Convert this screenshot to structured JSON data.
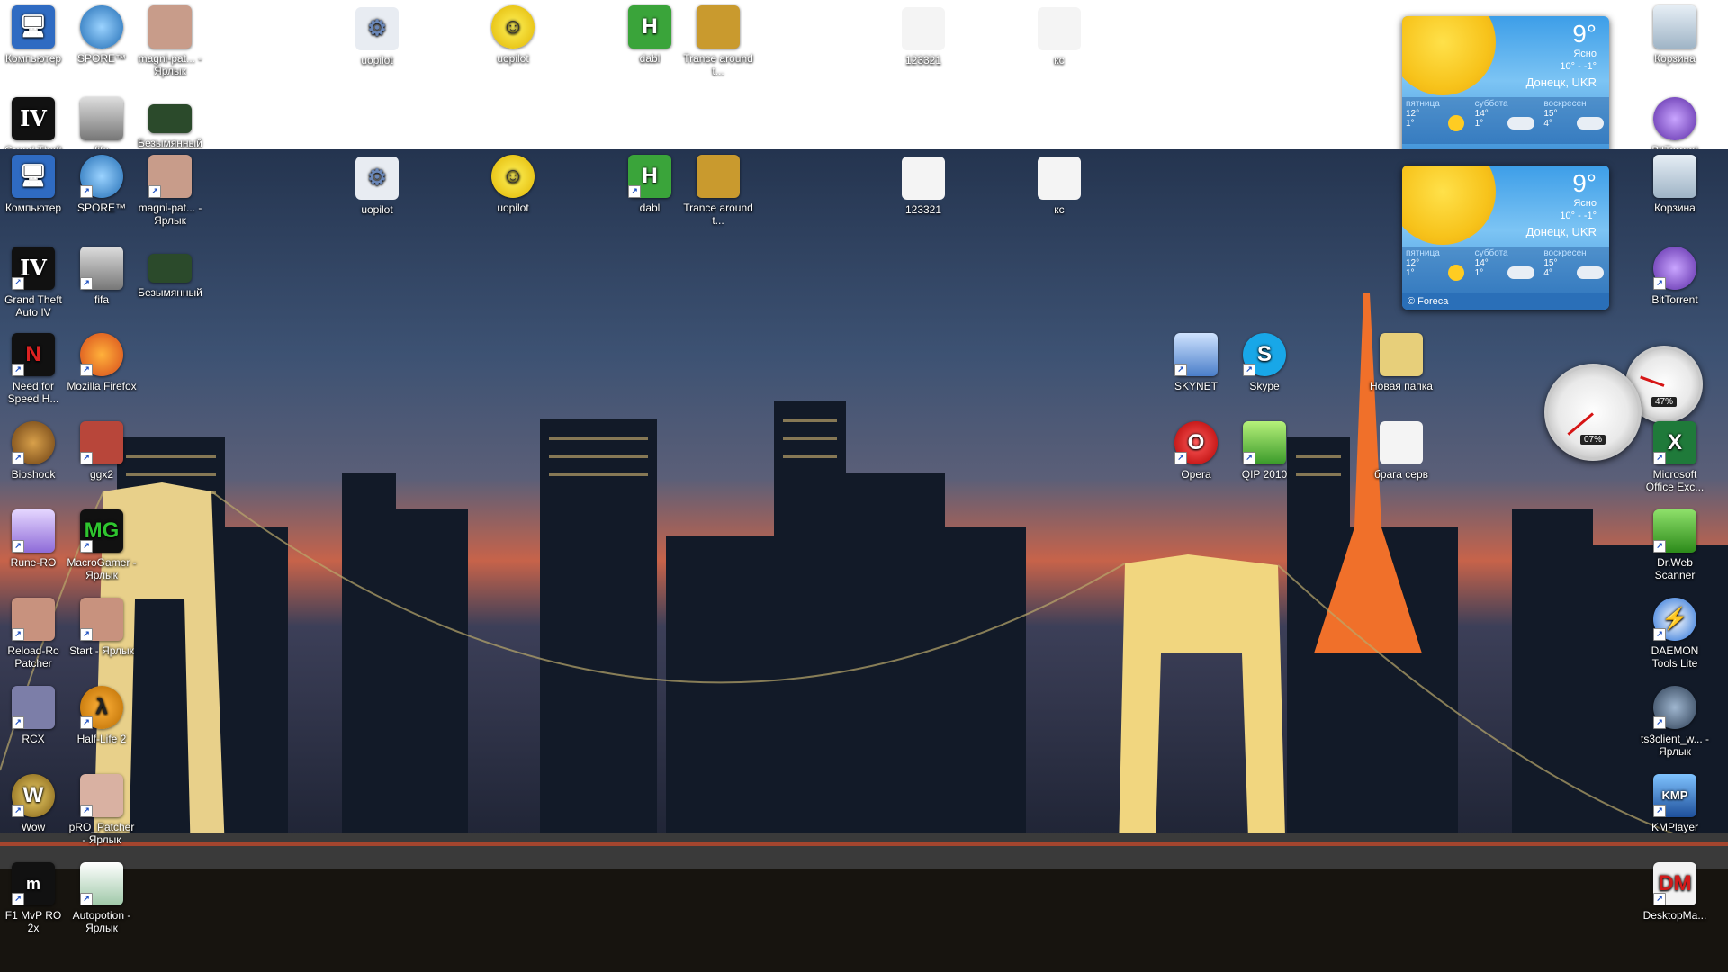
{
  "desktop": {
    "left_col1": [
      "Компьютер",
      "Grand Theft Auto IV",
      "Need for Speed H...",
      "Bioshock",
      "Rune-RO",
      "Reload-Ro Patcher",
      "RCX",
      "Wow",
      "F1 MvP RO 2x"
    ],
    "left_col2": [
      "SPORE™",
      "fifa",
      "Mozilla Firefox",
      "ggx2",
      "MacroGamer - Ярлык",
      "Start - Ярлык",
      "Half-Life 2",
      "pRO_Patcher - Ярлык",
      "Autopotion - Ярлык"
    ],
    "left_col3": [
      "magni-pat... - Ярлык",
      "Безымянный"
    ],
    "top_row": [
      "uopilot",
      "uopilot",
      "dabl",
      "Trance around t...",
      "123321",
      "кс"
    ],
    "mid_col1": [
      "SKYNET",
      "Opera"
    ],
    "mid_col2": [
      "Skype",
      "QIP 2010"
    ],
    "mid_col3": [
      "Новая папка",
      "брага серв"
    ],
    "right_col": [
      "Корзина",
      "BitTorrent",
      "Microsoft Office Exc...",
      "Dr.Web Scanner",
      "DAEMON Tools Lite",
      "ts3client_w... - Ярлык",
      "KMPlayer",
      "DesktopMa..."
    ]
  },
  "weather": {
    "temp": "9°",
    "condition": "Ясно",
    "range": "10° - -1°",
    "city": "Донецк, UKR",
    "days": [
      {
        "name": "пятница",
        "hi": "12°",
        "lo": "1°",
        "icon": "sun-icon"
      },
      {
        "name": "суббота",
        "hi": "14°",
        "lo": "1°",
        "icon": "cloud-icon"
      },
      {
        "name": "воскресен",
        "hi": "15°",
        "lo": "4°",
        "icon": "cloud-icon"
      }
    ],
    "footer": "© Foreca"
  },
  "gauges": {
    "cpu": "07%",
    "memory": "47%"
  },
  "colors": {
    "sky_top": "#2c3f5c",
    "sky_mid": "#3b5377",
    "sunset": "#d76a48",
    "city": "#0f1522"
  }
}
